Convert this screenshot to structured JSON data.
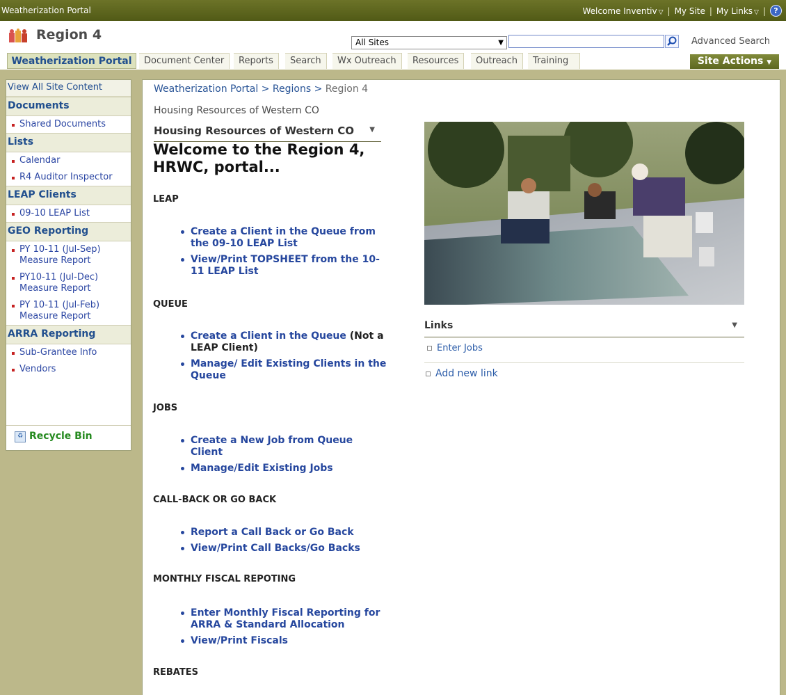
{
  "topbar": {
    "title": "Weatherization Portal",
    "welcome": "Welcome Inventiv",
    "my_site": "My Site",
    "my_links": "My Links",
    "help": "?"
  },
  "header": {
    "site_title": "Region 4",
    "search_scope": "All Sites",
    "search_value": "",
    "advanced_search": "Advanced Search"
  },
  "nav": {
    "home": "Weatherization Portal",
    "tabs": [
      "Document Center",
      "Reports",
      "Search",
      "Wx Outreach",
      "Resources",
      "Outreach",
      "Training"
    ],
    "site_actions": "Site Actions"
  },
  "quicklaunch": {
    "view_all": "View All Site Content",
    "groups": [
      {
        "heading": "Documents",
        "items": [
          "Shared Documents"
        ]
      },
      {
        "heading": "Lists",
        "items": [
          "Calendar",
          "R4 Auditor Inspector"
        ]
      },
      {
        "heading": "LEAP Clients",
        "items": [
          "09-10 LEAP List"
        ]
      },
      {
        "heading": "GEO Reporting",
        "items": [
          "PY 10-11 (Jul-Sep) Measure Report",
          "PY10-11 (Jul-Dec) Measure Report",
          "PY 10-11 (Jul-Feb) Measure Report"
        ]
      },
      {
        "heading": "ARRA Reporting",
        "items": [
          "Sub-Grantee Info",
          "Vendors"
        ]
      }
    ],
    "recycle_bin": "Recycle Bin"
  },
  "main": {
    "breadcrumb": [
      "Weatherization Portal",
      "Regions",
      "Region 4"
    ],
    "breadcrumb_sep": ">",
    "org_name": "Housing Resources of Western CO",
    "org_dropdown": "Housing Resources of Western CO",
    "welcome": "Welcome to the Region 4, HRWC, portal...",
    "sections": [
      {
        "title": "LEAP",
        "links": [
          "Create a Client in the Queue from the 09-10 LEAP List",
          "View/Print TOPSHEET from the 10-11 LEAP List"
        ]
      },
      {
        "title": "QUEUE",
        "links": [
          "Create a Client in the Queue",
          "Manage/ Edit Existing Clients in the Queue"
        ],
        "note": "(Not a LEAP Client)"
      },
      {
        "title": "JOBS",
        "links": [
          "Create a New Job from Queue Client",
          "Manage/Edit Existing Jobs"
        ]
      },
      {
        "title": "CALL-BACK OR GO BACK",
        "links": [
          "Report a Call Back or Go Back",
          "View/Print Call Backs/Go Backs"
        ]
      },
      {
        "title": "MONTHLY FISCAL REPOTING",
        "links": [
          "Enter Monthly Fiscal Reporting for ARRA & Standard Allocation",
          "View/Print Fiscals"
        ]
      },
      {
        "title": "REBATES",
        "links": []
      }
    ],
    "links_webpart": {
      "title": "Links",
      "items": [
        "Enter Jobs"
      ],
      "add_new": "Add new link"
    }
  },
  "colors": {
    "topbar": "#5e6620",
    "link": "#26479e",
    "accent": "#dde2bd"
  }
}
